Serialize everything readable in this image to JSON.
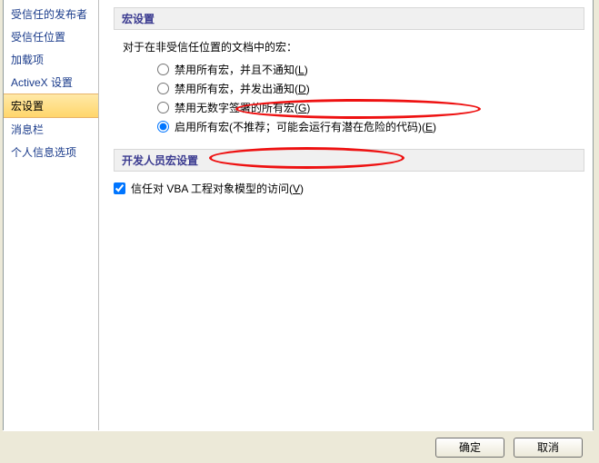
{
  "sidebar": {
    "items": [
      {
        "label": "受信任的发布者"
      },
      {
        "label": "受信任位置"
      },
      {
        "label": "加载项"
      },
      {
        "label": "ActiveX 设置"
      },
      {
        "label": "宏设置"
      },
      {
        "label": "消息栏"
      },
      {
        "label": "个人信息选项"
      }
    ],
    "selected_index": 4
  },
  "content": {
    "section1_title": "宏设置",
    "intro": "对于在非受信任位置的文档中的宏：",
    "radios": [
      {
        "label": "禁用所有宏，并且不通知",
        "key": "L",
        "checked": false
      },
      {
        "label": "禁用所有宏，并发出通知",
        "key": "D",
        "checked": false
      },
      {
        "label": "禁用无数字签署的所有宏",
        "key": "G",
        "checked": false
      },
      {
        "label": "启用所有宏(不推荐；可能会运行有潜在危险的代码)",
        "key": "E",
        "checked": true
      }
    ],
    "section2_title": "开发人员宏设置",
    "checkbox": {
      "label": "信任对 VBA 工程对象模型的访问",
      "key": "V",
      "checked": true
    }
  },
  "buttons": {
    "ok": "确定",
    "cancel": "取消"
  }
}
